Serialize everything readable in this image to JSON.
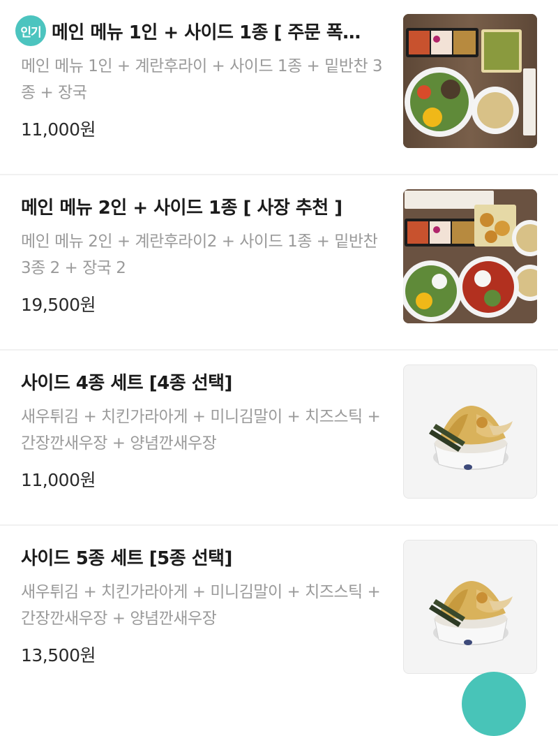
{
  "menu": {
    "items": [
      {
        "badge": "인기",
        "title": "메인 메뉴 1인 + 사이드 1종 [ 주문 폭…",
        "description": "메인 메뉴 1인 + 계란후라이 + 사이드 1종 + 밑반찬 3종 + 장국",
        "price": "11,000원"
      },
      {
        "title": "메인 메뉴 2인 + 사이드 1종 [ 사장 추천 ]",
        "description": "메인 메뉴 2인 + 계란후라이2 + 사이드 1종 + 밑반찬 3종 2 + 장국 2",
        "price": "19,500원"
      },
      {
        "title": "사이드 4종 세트 [4종 선택]",
        "description": "새우튀김 + 치킨가라아게 + 미니김말이 + 치즈스틱 + 간장깐새우장 + 양념깐새우장",
        "price": "11,000원"
      },
      {
        "title": "사이드 5종 세트 [5종 선택]",
        "description": "새우튀김 + 치킨가라아게 + 미니김말이 + 치즈스틱 + 간장깐새우장 + 양념깐새우장",
        "price": "13,500원"
      }
    ]
  },
  "colors": {
    "badge": "#4cc4bf",
    "floating_button": "#48c4b8",
    "description_text": "#9a9a9a"
  }
}
